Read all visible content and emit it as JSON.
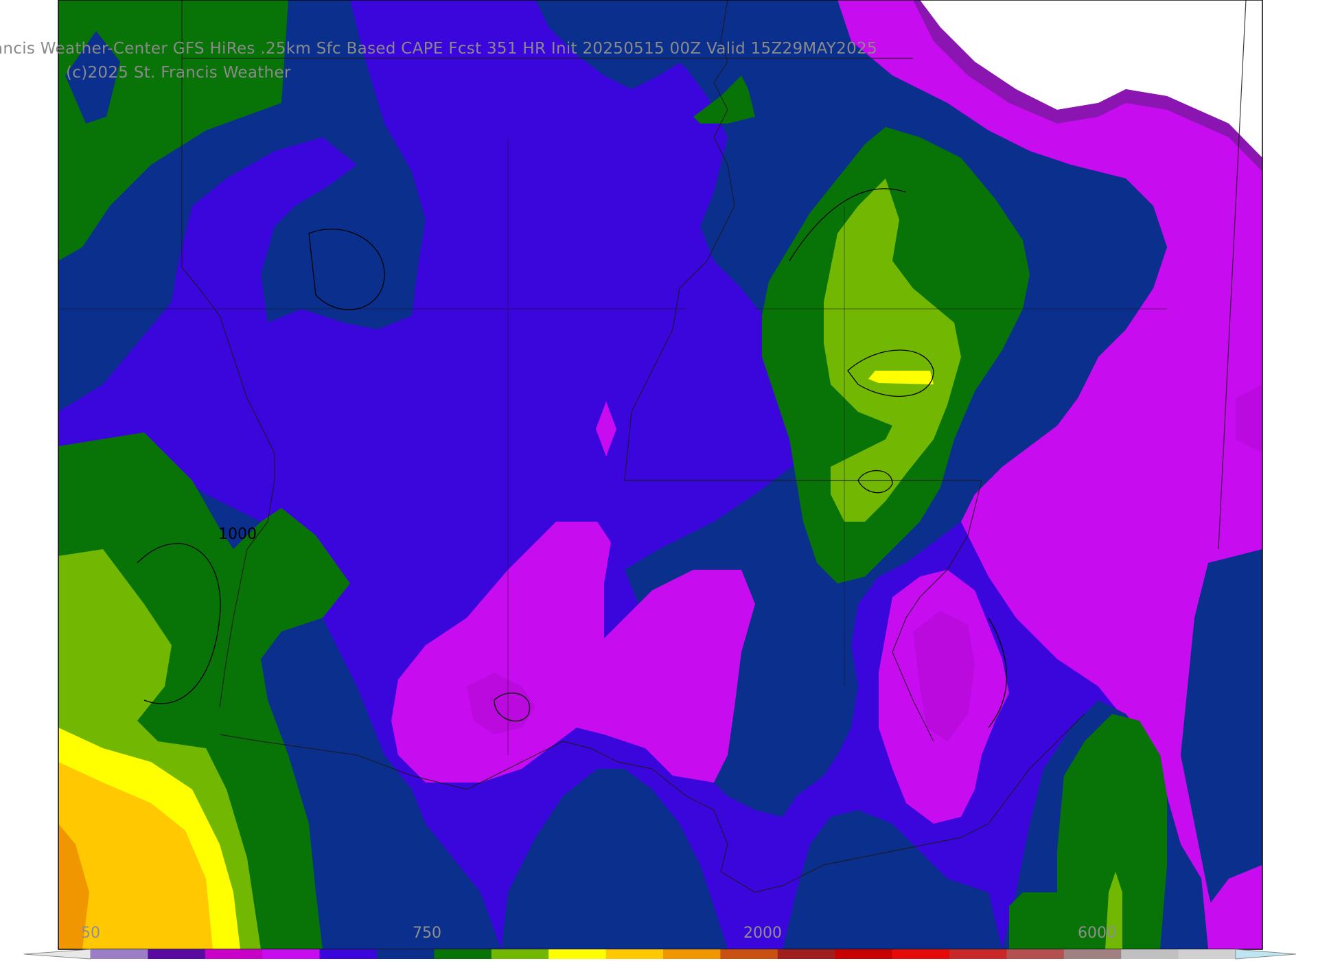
{
  "header": {
    "title": "ancis Weather-Center GFS HiRes .25km Sfc Based CAPE  Fcst 351 HR Init 20250515 00Z  Valid 15Z29MAY2025",
    "copyright": "(c)2025 St. Francis Weather"
  },
  "map": {
    "field": "Sfc Based CAPE",
    "contour_label": "1000",
    "fill_colors": {
      "navy": "#0b2f8c",
      "blue_violet": "#3a06dc",
      "magenta": "#c80cf0",
      "dark_green": "#087408",
      "light_green": "#72b802",
      "yellow": "#ffff00",
      "gold": "#ffc800",
      "orange": "#f09600"
    }
  },
  "colorbar": {
    "tick_labels": [
      "50",
      "750",
      "2000",
      "6000"
    ],
    "colors": [
      "#9a7ec6",
      "#5a0aa0",
      "#c800c8",
      "#c80cf0",
      "#3a06dc",
      "#0b2f8c",
      "#087408",
      "#72b802",
      "#ffff00",
      "#ffc800",
      "#f09600",
      "#c85010",
      "#a01e1e",
      "#c80000",
      "#e60a0a",
      "#c82828",
      "#b45050",
      "#a08080",
      "#c0c0c0",
      "#d0d0d0"
    ]
  }
}
